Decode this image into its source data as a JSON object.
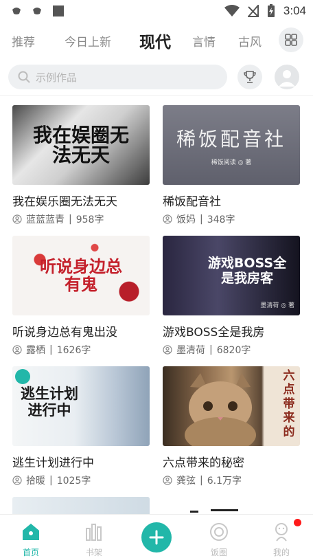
{
  "status_bar": {
    "time": "3:04"
  },
  "tabs": [
    "推荐",
    "今日上新",
    "现代",
    "言情",
    "古风"
  ],
  "search": {
    "placeholder": "示例作品"
  },
  "books": [
    {
      "title": "我在娱乐圈无法无天",
      "author": "蓝蓝蓝青",
      "words": "958字",
      "cover_text": "我在娱圈无法无天"
    },
    {
      "title": "稀饭配音社",
      "author": "饭妈",
      "words": "348字",
      "cover_text": "稀饭配音社",
      "cover_sub": "稀饭阅读 ◎ 著"
    },
    {
      "title": "听说身边总有鬼出没",
      "author": "露栖",
      "words": "1626字",
      "cover_text": "听说身边总有鬼"
    },
    {
      "title": "游戏BOSS全是我房",
      "author": "墨清荷",
      "words": "6820字",
      "cover_text": "游戏BOSS全是我房客",
      "cover_sub": "墨清荷 ◎ 著"
    },
    {
      "title": "逃生计划进行中",
      "author": "拾暖",
      "words": "1025字",
      "cover_text": "逃生计划进行中"
    },
    {
      "title": "六点带来的秘密",
      "author": "龚弦",
      "words": "6.1万字",
      "cover_text": "六点带来的"
    }
  ],
  "bottom_nav": [
    {
      "label": "首页"
    },
    {
      "label": "书架"
    },
    {
      "label": "饭圈"
    },
    {
      "label": "我的"
    }
  ],
  "colors": {
    "accent": "#22b7a9",
    "badge": "#ff1a1a"
  }
}
